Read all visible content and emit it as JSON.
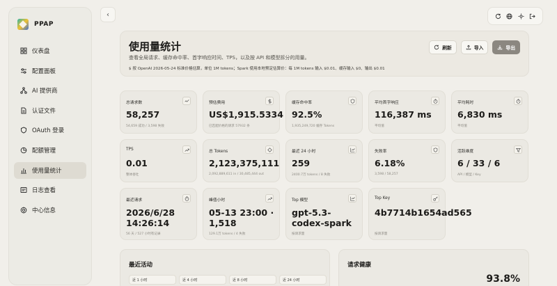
{
  "app": {
    "name": "PPAP"
  },
  "sidebar": {
    "items": [
      {
        "label": "仪表盘",
        "icon": "grid-icon",
        "active": false
      },
      {
        "label": "配置面板",
        "icon": "sliders-icon",
        "active": false
      },
      {
        "label": "AI 提供商",
        "icon": "network-icon",
        "active": false
      },
      {
        "label": "认证文件",
        "icon": "file-icon",
        "active": false
      },
      {
        "label": "OAuth 登录",
        "icon": "shield-icon",
        "active": false
      },
      {
        "label": "配额管理",
        "icon": "pie-icon",
        "active": false
      },
      {
        "label": "使用量统计",
        "icon": "bar-chart-icon",
        "active": true
      },
      {
        "label": "日志查看",
        "icon": "log-icon",
        "active": false
      },
      {
        "label": "中心信息",
        "icon": "target-icon",
        "active": false
      }
    ]
  },
  "header": {
    "title": "使用量统计",
    "subtitle": "查看全局请求、缓存命中率、首字响应时间、TPS，以及按 API 和模型拆分的用量。",
    "price_note": "$ 按 OpenAI 2026-05-24 标准价格估算，单位 1M tokens；Spark 使用本地预定估算价：每 1M tokens 输入 $0.01、缓存输入 $0、输出 $0.01",
    "actions": {
      "refresh": "刷新",
      "import": "导入",
      "export": "导出"
    }
  },
  "metrics": [
    {
      "label": "总请求数",
      "value": "58,257",
      "desc": "54,659 成功 / 3,598 失败",
      "icon": "pulse-icon"
    },
    {
      "label": "预估费用",
      "value": "US$1,915.5334",
      "desc": "已匹配价格的请求 57932 条",
      "icon": "dollar-icon"
    },
    {
      "label": "缓存命中率",
      "value": "92.5%",
      "desc": "1,935,249,720 缓存 Tokens",
      "icon": "shield-icon"
    },
    {
      "label": "平均首字响应",
      "value": "116,387 ms",
      "desc": "平均值",
      "icon": "timer-icon"
    },
    {
      "label": "平均耗时",
      "value": "6,830 ms",
      "desc": "平均值",
      "icon": "timer-icon"
    },
    {
      "label": "TPS",
      "value": "0.01",
      "desc": "整体吞吐",
      "icon": "trend-icon"
    },
    {
      "label": "总 Tokens",
      "value": "2,123,375,111",
      "desc": "2,092,889,611 in / 30,485,444 out",
      "icon": "diamond-icon"
    },
    {
      "label": "最近 24 小时",
      "value": "259",
      "desc": "2400.7万 tokens / 8 失败",
      "icon": "chart-icon"
    },
    {
      "label": "失败率",
      "value": "6.18%",
      "desc": "3,598 / 58,257",
      "icon": "shield-icon"
    },
    {
      "label": "活跃维度",
      "value": "6 / 33 / 6",
      "desc": "API / 模型 / Key",
      "icon": "filter-icon"
    },
    {
      "label": "最近请求",
      "value": "2026/6/28 14:26:14",
      "desc": "56 天 / 527 小时有记录",
      "icon": "timer-icon"
    },
    {
      "label": "峰值小时",
      "value": "05-13 23:00 · 1,518",
      "desc": "129.1万 tokens / 4 失败",
      "icon": "trend-icon"
    },
    {
      "label": "Top 模型",
      "value": "gpt-5.3-codex-spark",
      "desc": "按请求量",
      "icon": "chart-icon"
    },
    {
      "label": "Top Key",
      "value": "4b7714b1654ad565",
      "desc": "按请求量",
      "icon": "key-icon"
    }
  ],
  "activity": {
    "title": "最近活动",
    "tabs": [
      "近 1 小时",
      "近 4 小时",
      "近 8 小时",
      "近 24 小时"
    ]
  },
  "health": {
    "title": "请求健康",
    "rate": "93.8%"
  }
}
